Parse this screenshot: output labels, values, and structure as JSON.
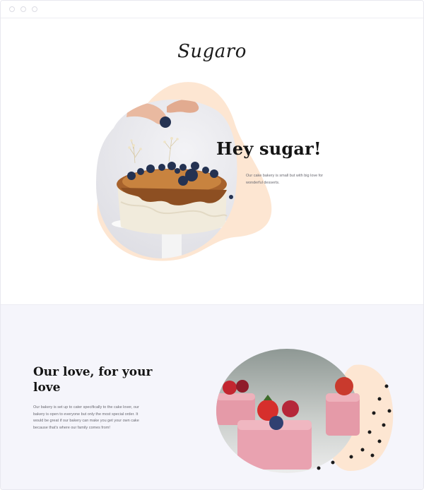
{
  "window": {
    "controls": [
      "close",
      "minimize",
      "maximize"
    ]
  },
  "brand": {
    "logo_text": "Sugaro"
  },
  "hero": {
    "title": "Hey sugar!",
    "text": "Our cake bakery is small but with big love for wonderful desserts.",
    "image_icon": "cake-with-blueberries-image",
    "accent_color": "#fde6d2"
  },
  "section2": {
    "title": "Our love, for your love",
    "text": "Our bakery is set up to cater specifically to the cake lover, our bakery is open to everyone but only the most special order. It would be great if our bakery can make you get your own cake because that's where our family comes from!",
    "image_icon": "strawberry-petit-fours-image",
    "background_color": "#f5f5fb",
    "accent_color": "#fde6d2"
  }
}
